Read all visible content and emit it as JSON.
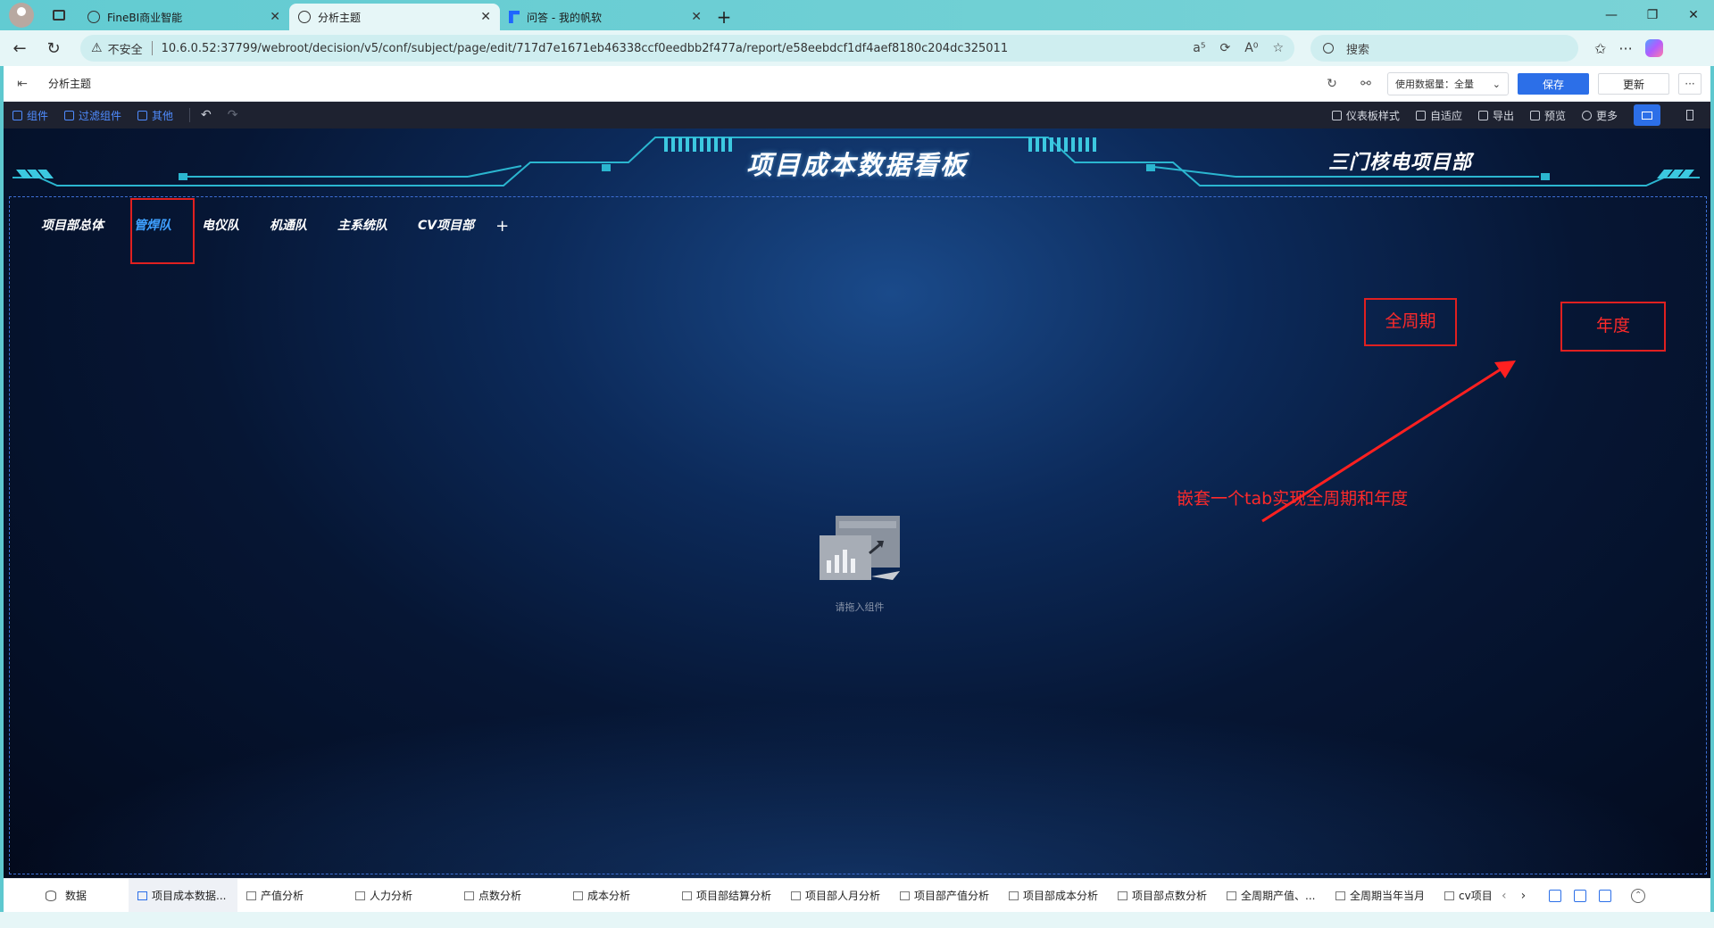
{
  "browser": {
    "tabs": [
      {
        "title": "FineBI商业智能",
        "active": false,
        "icon": "globe-icon"
      },
      {
        "title": "分析主题",
        "active": true,
        "icon": "globe-icon"
      },
      {
        "title": "问答 - 我的帆软",
        "active": false,
        "icon": "fanruan-icon"
      }
    ],
    "new_tab": "+",
    "address": {
      "warning": "不安全",
      "url": "10.6.0.52:37799/webroot/decision/v5/conf/subject/page/edit/717d7e1671eb46338ccf0eedbb2f477a/report/e58eebdcf1df4aef8180c204dc325011"
    },
    "search_placeholder": "搜索"
  },
  "app_header": {
    "title": "分析主题",
    "data_amount": "使用数据量：全量",
    "save_label": "保存",
    "update_label": "更新",
    "more_label": "···"
  },
  "toolbar": {
    "left": [
      "组件",
      "过滤组件",
      "其他"
    ],
    "right": [
      "仪表板样式",
      "自适应",
      "导出",
      "预览",
      "更多"
    ]
  },
  "dashboard": {
    "title": "项目成本数据看板",
    "department": "三门核电项目部",
    "tabs": [
      "项目部总体",
      "管焊队",
      "电仪队",
      "机通队",
      "主系统队",
      "CV项目部"
    ],
    "active_tab": 1,
    "add_tab": "+",
    "placeholder_hint": "请拖入组件"
  },
  "annotations": {
    "box_full_cycle": "全周期",
    "box_year": "年度",
    "note": "嵌套一个tab实现全周期和年度",
    "color": "#e02020"
  },
  "sheets": {
    "data_label": "数据",
    "tabs": [
      "项目成本数据...",
      "产值分析",
      "人力分析",
      "点数分析",
      "成本分析",
      "项目部结算分析",
      "项目部人月分析",
      "项目部产值分析",
      "项目部成本分析",
      "项目部点数分析",
      "全周期产值、...",
      "全周期当年当月",
      "cv项目"
    ],
    "active": 0
  },
  "colors": {
    "accent": "#2c6fe8",
    "active_tab": "#3fa0ff",
    "canvas_bg": "#061634"
  }
}
